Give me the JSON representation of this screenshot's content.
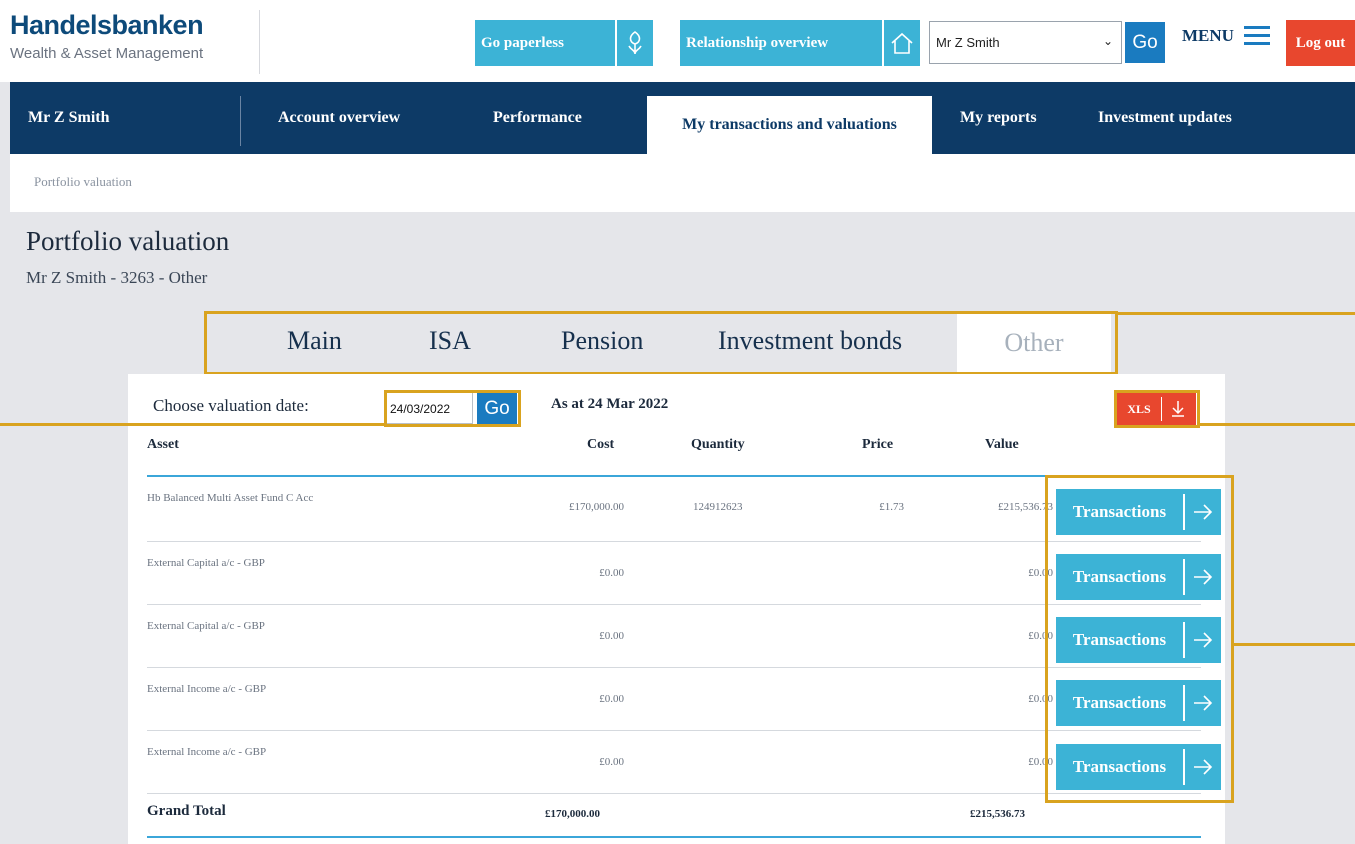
{
  "brand": {
    "name": "Handelsbanken",
    "subtitle": "Wealth & Asset Management"
  },
  "header": {
    "go_paperless": "Go paperless",
    "relationship_overview": "Relationship overview",
    "client_select_value": "Mr Z Smith",
    "go_label": "Go",
    "menu_label": "MENU",
    "logout_label": "Log out"
  },
  "nav": {
    "client_name": "Mr Z Smith",
    "items": [
      "Account overview",
      "Performance",
      "My transactions and valuations",
      "My reports",
      "Investment updates"
    ],
    "active_index": 2
  },
  "breadcrumb": "Portfolio valuation",
  "page": {
    "title": "Portfolio valuation",
    "subtitle": "Mr Z Smith - 3263 - Other"
  },
  "tabs": [
    "Main",
    "ISA",
    "Pension",
    "Investment bonds",
    "Other"
  ],
  "valuation": {
    "date_label": "Choose valuation date:",
    "date_value": "24/03/2022",
    "go_label": "Go",
    "as_at": "As at 24 Mar 2022",
    "xls_label": "XLS"
  },
  "table": {
    "headers": {
      "asset": "Asset",
      "cost": "Cost",
      "quantity": "Quantity",
      "price": "Price",
      "value": "Value"
    },
    "rows": [
      {
        "asset": "Hb Balanced Multi Asset Fund C Acc",
        "cost": "£170,000.00",
        "quantity": "124912623",
        "price": "£1.73",
        "value": "£215,536.73",
        "action": "Transactions"
      },
      {
        "asset": "External Capital a/c - GBP",
        "cost": "£0.00",
        "quantity": "",
        "price": "",
        "value": "£0.00",
        "action": "Transactions"
      },
      {
        "asset": "External Capital a/c - GBP",
        "cost": "£0.00",
        "quantity": "",
        "price": "",
        "value": "£0.00",
        "action": "Transactions"
      },
      {
        "asset": "External Income a/c - GBP",
        "cost": "£0.00",
        "quantity": "",
        "price": "",
        "value": "£0.00",
        "action": "Transactions"
      },
      {
        "asset": "External Income a/c - GBP",
        "cost": "£0.00",
        "quantity": "",
        "price": "",
        "value": "£0.00",
        "action": "Transactions"
      }
    ],
    "grand_total": {
      "label": "Grand Total",
      "cost": "£170,000.00",
      "value": "£215,536.73"
    }
  },
  "colors": {
    "navy": "#0d3a66",
    "accent_blue": "#3cb3d6",
    "go_blue": "#1a7bc0",
    "logout_red": "#e8472e",
    "highlight_gold": "#d9a31f"
  }
}
